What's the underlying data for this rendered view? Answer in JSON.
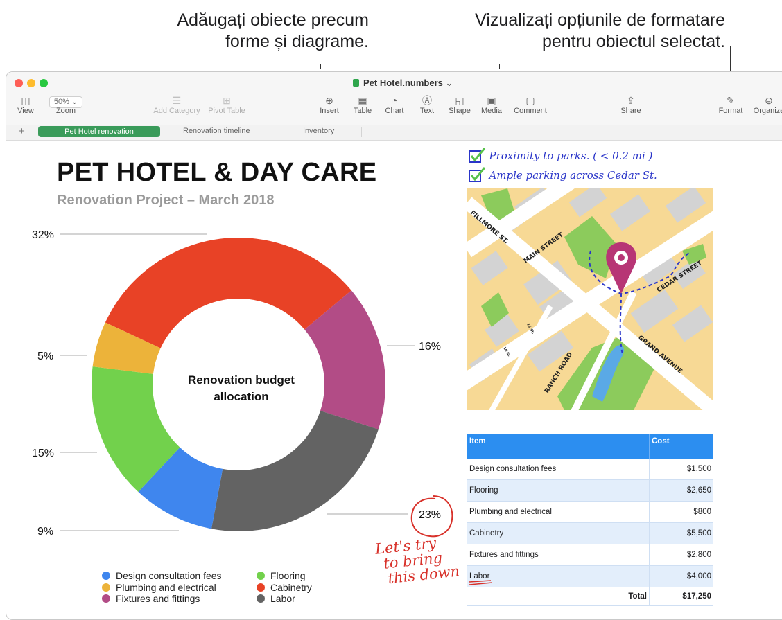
{
  "callouts": {
    "left_line1": "Adăugați obiecte precum",
    "left_line2": "forme și diagrame.",
    "right_line1": "Vizualizați opțiunile de formatare",
    "right_line2": "pentru obiectul selectat."
  },
  "window": {
    "title": "Pet Hotel.numbers",
    "title_chevron": "⌄",
    "traffic_colors": [
      "#fe5f57",
      "#febc2e",
      "#28c840"
    ]
  },
  "toolbar": {
    "view": "View",
    "zoom_value": "50%",
    "zoom_chevron": "⌄",
    "zoom": "Zoom",
    "add_category": "Add Category",
    "pivot_table": "Pivot Table",
    "insert": "Insert",
    "table": "Table",
    "chart": "Chart",
    "text": "Text",
    "shape": "Shape",
    "media": "Media",
    "comment": "Comment",
    "share": "Share",
    "format": "Format",
    "organize": "Organize"
  },
  "tabs": {
    "add": "+",
    "items": [
      "Pet Hotel renovation",
      "Renovation timeline",
      "Inventory"
    ],
    "active_index": 0
  },
  "doc": {
    "title": "PET HOTEL & DAY CARE",
    "subtitle": "Renovation Project – March 2018"
  },
  "chart_data": {
    "type": "pie",
    "donut": true,
    "title": "Renovation budget allocation",
    "categories": [
      "Cabinetry",
      "Fixtures and fittings",
      "Labor",
      "Design consultation fees",
      "Flooring",
      "Plumbing and electrical"
    ],
    "values": [
      32,
      16,
      23,
      9,
      15,
      5
    ],
    "labels": [
      "32%",
      "16%",
      "23%",
      "9%",
      "15%",
      "5%"
    ],
    "colors": [
      "#e84226",
      "#b24c86",
      "#636363",
      "#3f86ee",
      "#72d14c",
      "#ecb33a"
    ],
    "legend": [
      {
        "label": "Design consultation fees",
        "color": "#3f86ee"
      },
      {
        "label": "Plumbing and electrical",
        "color": "#ecb33a"
      },
      {
        "label": "Fixtures and fittings",
        "color": "#b24c86"
      },
      {
        "label": "Flooring",
        "color": "#72d14c"
      },
      {
        "label": "Cabinetry",
        "color": "#e84226"
      },
      {
        "label": "Labor",
        "color": "#636363"
      }
    ],
    "legend_position": "bottom"
  },
  "notes": {
    "check1": "Proximity to parks. ( < 0.2 mi )",
    "check2": "Ample parking across Cedar St.",
    "annot_line1": "Let's try",
    "annot_line2": "to bring",
    "annot_line3": "this down",
    "ink_color": "#2a35c9",
    "red_ink": "#d8322b"
  },
  "map": {
    "streets": {
      "filmore": "FILLMORE ST.",
      "main": "MAIN STREET",
      "cedar": "CEDAR STREET",
      "grand": "GRAND AVENUE",
      "ranch": "RANCH ROAD",
      "small1": "16 St.",
      "small2": "16 St."
    }
  },
  "cost_table": {
    "headers": [
      "Item",
      "Cost"
    ],
    "rows": [
      {
        "item": "Design consultation fees",
        "cost": "$1,500"
      },
      {
        "item": "Flooring",
        "cost": "$2,650"
      },
      {
        "item": "Plumbing and electrical",
        "cost": "$800"
      },
      {
        "item": "Cabinetry",
        "cost": "$5,500"
      },
      {
        "item": "Fixtures and fittings",
        "cost": "$2,800"
      },
      {
        "item": "Labor",
        "cost": "$4,000"
      }
    ],
    "total_label": "Total",
    "total_value": "$17,250"
  }
}
